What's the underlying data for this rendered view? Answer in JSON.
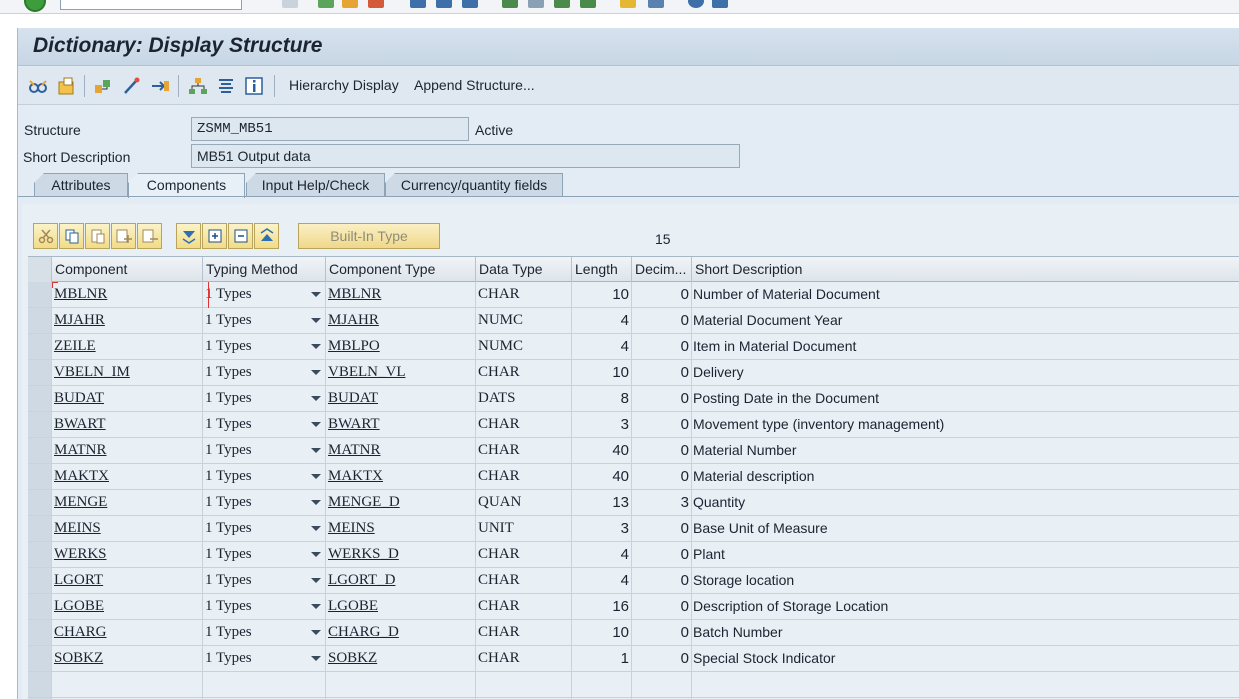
{
  "window": {
    "title": "Dictionary: Display Structure"
  },
  "toolbar": {
    "hierarchy_label": "Hierarchy Display",
    "append_label": "Append Structure..."
  },
  "header": {
    "structure_label": "Structure",
    "structure_value": "ZSMM_MB51",
    "status": "Active",
    "short_desc_label": "Short Description",
    "short_desc_value": "MB51 Output data"
  },
  "tabs": [
    {
      "label": "Attributes"
    },
    {
      "label": "Components"
    },
    {
      "label": "Input Help/Check"
    },
    {
      "label": "Currency/quantity fields"
    }
  ],
  "grid": {
    "builtin_label": "Built-In Type",
    "count": "15",
    "columns": [
      "Component",
      "Typing Method",
      "Component Type",
      "Data Type",
      "Length",
      "Decim...",
      "Short Description"
    ],
    "rows": [
      {
        "component": "MBLNR",
        "typing": "1 Types",
        "type": "MBLNR",
        "datatype": "CHAR",
        "length": "10",
        "decimals": "0",
        "desc": "Number of Material Document"
      },
      {
        "component": "MJAHR",
        "typing": "1 Types",
        "type": "MJAHR",
        "datatype": "NUMC",
        "length": "4",
        "decimals": "0",
        "desc": "Material Document Year"
      },
      {
        "component": "ZEILE",
        "typing": "1 Types",
        "type": "MBLPO",
        "datatype": "NUMC",
        "length": "4",
        "decimals": "0",
        "desc": "Item in Material Document"
      },
      {
        "component": "VBELN_IM",
        "typing": "1 Types",
        "type": "VBELN_VL",
        "datatype": "CHAR",
        "length": "10",
        "decimals": "0",
        "desc": "Delivery"
      },
      {
        "component": "BUDAT",
        "typing": "1 Types",
        "type": "BUDAT",
        "datatype": "DATS",
        "length": "8",
        "decimals": "0",
        "desc": "Posting Date in the Document"
      },
      {
        "component": "BWART",
        "typing": "1 Types",
        "type": "BWART",
        "datatype": "CHAR",
        "length": "3",
        "decimals": "0",
        "desc": "Movement type (inventory management)"
      },
      {
        "component": "MATNR",
        "typing": "1 Types",
        "type": "MATNR",
        "datatype": "CHAR",
        "length": "40",
        "decimals": "0",
        "desc": "Material Number"
      },
      {
        "component": "MAKTX",
        "typing": "1 Types",
        "type": "MAKTX",
        "datatype": "CHAR",
        "length": "40",
        "decimals": "0",
        "desc": "Material description"
      },
      {
        "component": "MENGE",
        "typing": "1 Types",
        "type": "MENGE_D",
        "datatype": "QUAN",
        "length": "13",
        "decimals": "3",
        "desc": "Quantity"
      },
      {
        "component": "MEINS",
        "typing": "1 Types",
        "type": "MEINS",
        "datatype": "UNIT",
        "length": "3",
        "decimals": "0",
        "desc": "Base Unit of Measure"
      },
      {
        "component": "WERKS",
        "typing": "1 Types",
        "type": "WERKS_D",
        "datatype": "CHAR",
        "length": "4",
        "decimals": "0",
        "desc": "Plant"
      },
      {
        "component": "LGORT",
        "typing": "1 Types",
        "type": "LGORT_D",
        "datatype": "CHAR",
        "length": "4",
        "decimals": "0",
        "desc": "Storage location"
      },
      {
        "component": "LGOBE",
        "typing": "1 Types",
        "type": "LGOBE",
        "datatype": "CHAR",
        "length": "16",
        "decimals": "0",
        "desc": "Description of Storage Location"
      },
      {
        "component": "CHARG",
        "typing": "1 Types",
        "type": "CHARG_D",
        "datatype": "CHAR",
        "length": "10",
        "decimals": "0",
        "desc": "Batch Number"
      },
      {
        "component": "SOBKZ",
        "typing": "1 Types",
        "type": "SOBKZ",
        "datatype": "CHAR",
        "length": "1",
        "decimals": "0",
        "desc": "Special Stock Indicator"
      }
    ]
  },
  "icons": {
    "toolbar": [
      "glasses-icon",
      "transport-icon",
      "hierarchy-object-icon",
      "wand-icon",
      "where-used-icon",
      "tree-icon",
      "list-icon",
      "info-icon"
    ],
    "grid_toolbar": [
      "cut-icon",
      "copy-icon",
      "paste-icon",
      "insert-row-icon",
      "delete-row-icon",
      "filter-down-icon",
      "expand-icon",
      "collapse-icon",
      "filter-up-icon"
    ]
  }
}
